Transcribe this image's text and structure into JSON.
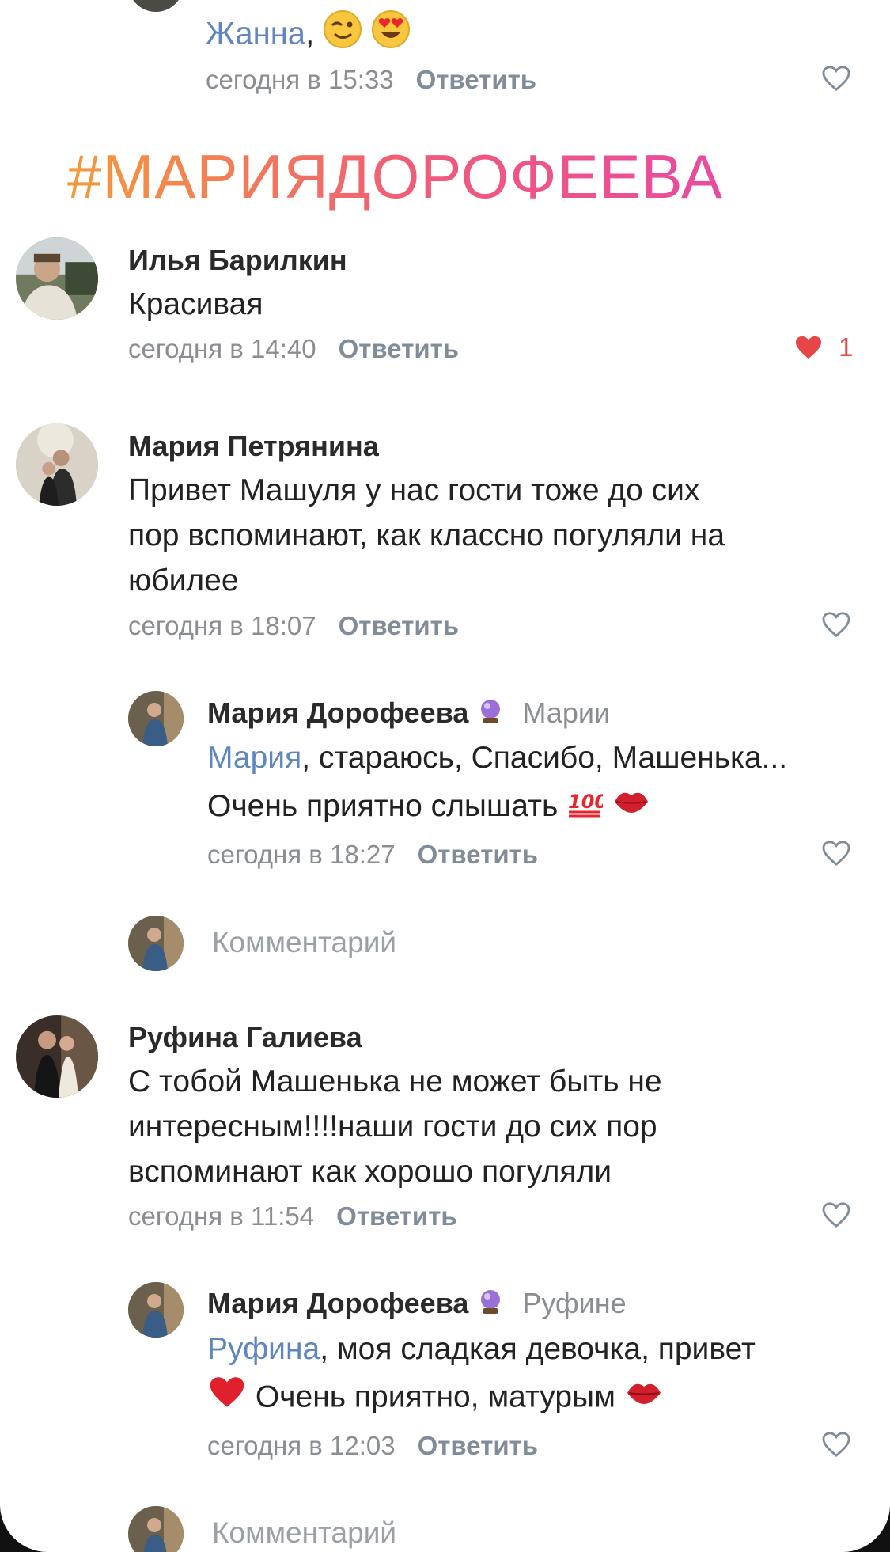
{
  "top_comment": {
    "mention": "Жанна",
    "comma": ",",
    "time": "сегодня в 15:33",
    "reply_label": "Ответить"
  },
  "hashtag": "#МАРИЯДОРОФЕЕВА",
  "comments": [
    {
      "author": "Илья Барилкин",
      "text_lines": [
        "Красивая"
      ],
      "time": "сегодня в 14:40",
      "reply_label": "Ответить",
      "likes": "1"
    },
    {
      "author": "Мария Петрянина",
      "text_lines": [
        "Привет Машуля у нас гости тоже до сих",
        "пор вспоминают, как классно погуляли на",
        "юбилее"
      ],
      "time": "сегодня в 18:07",
      "reply_label": "Ответить"
    },
    {
      "author": "Мария Дорофеева",
      "reply_to": "Марии",
      "mention": "Мария",
      "line1_rest": ", стараюсь, Спасибо, Машенька...",
      "line2": "Очень приятно слышать",
      "time": "сегодня в 18:27",
      "reply_label": "Ответить"
    },
    {
      "author": "Руфина Галиева",
      "text_lines": [
        "С тобой Машенька не может быть не",
        "интересным!!!!наши гости до сих пор",
        "вспоминают как хорошо погуляли"
      ],
      "time": "сегодня в 11:54",
      "reply_label": "Ответить"
    },
    {
      "author": "Мария Дорофеева",
      "reply_to": "Руфине",
      "mention": "Руфина",
      "line1_rest": ", моя сладкая девочка, привет",
      "line2": "Очень приятно, матурым",
      "time": "сегодня в 12:03",
      "reply_label": "Ответить"
    }
  ],
  "comment_placeholder": "Комментарий",
  "colors": {
    "mention": "#5f86bf",
    "meta": "#8a8d91",
    "like_red": "#e64646",
    "hashtag_gradient": [
      "#f39a3a",
      "#f05a7b",
      "#e94aa0"
    ]
  },
  "icons": [
    "winking-face-emoji",
    "heart-eyes-emoji",
    "crystal-ball-emoji",
    "hundred-points-emoji",
    "kiss-mark-emoji",
    "red-heart-emoji",
    "heart-outline-icon",
    "heart-filled-icon"
  ]
}
